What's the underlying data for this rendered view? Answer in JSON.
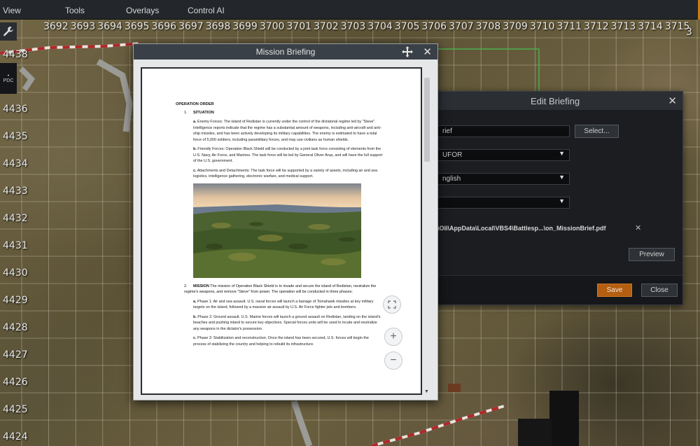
{
  "menu": {
    "items": [
      "View",
      "Tools",
      "Overlays",
      "Control AI"
    ]
  },
  "map": {
    "x_coords": [
      "3692",
      "3693",
      "3694",
      "3695",
      "3696",
      "3697",
      "3698",
      "3699",
      "3700",
      "3701",
      "3702",
      "3703",
      "3704",
      "3705",
      "3706",
      "3707",
      "3708",
      "3709",
      "3710",
      "3711",
      "3712",
      "3713",
      "3714",
      "3715"
    ],
    "y_coords": [
      "4438",
      "37",
      "4436",
      "4435",
      "4434",
      "4433",
      "4432",
      "4431",
      "4430",
      "4429",
      "4428",
      "4427",
      "4426",
      "4425",
      "4424"
    ],
    "y_coord_corner": "3",
    "colors": {
      "grid": "#c8c4b0",
      "road_red": "#b0282a",
      "road_white": "#e8e4dc"
    }
  },
  "left_tools": {
    "wrench_icon": "wrench-icon",
    "pdc_label": "PDC",
    "pdc_dot": "•"
  },
  "mission_briefing": {
    "title": "Mission Briefing",
    "move_icon": "move-icon",
    "close_label": "✕",
    "document": {
      "heading": "OPERATION ORDER",
      "section1_num": "1.",
      "section1_title": "SITUATION",
      "para_a_label": "a.",
      "para_a": "Enemy Forces: The island of Redistan is currently under the control of the dictatorial regime led by \"Steve\". Intelligence reports indicate that the regime has a substantial amount of weapons, including anti-aircraft and anti-ship missiles, and has been actively developing its military capabilities. The enemy is estimated to have a total force of 5,000 soldiers, including paramilitary forces, and may use civilians as human shields.",
      "para_b_label": "b.",
      "para_b": "Friendly Forces: Operation Black Shield will be conducted by a joint task force consisting of elements from the U.S. Navy, Air Force, and Marines. The task force will be led by General Oliver Arup, and will have the full support of the U.S. government.",
      "para_c_label": "c.",
      "para_c": "Attachments and Detachments: The task force will be supported by a variety of assets, including air and sea logistics, intelligence gathering, electronic warfare, and medical support.",
      "section2_num": "2.",
      "section2_title": "MISSION",
      "section2_text": "The mission of Operation Black Shield is to invade and secure the island of Redistan, neutralize the regime's weapons, and remove \"Steve\" from power. The operation will be conducted in three phases:",
      "phase1_label": "a.",
      "phase1": "Phase 1: Air and sea assault. U.S. naval forces will launch a barrage of Tomahawk missiles at key military targets on the island, followed by a massive air assault by U.S. Air Force fighter jets and bombers.",
      "phase2_label": "b.",
      "phase2": "Phase 2: Ground assault. U.S. Marine forces will launch a ground assault on Redistan, landing on the island's beaches and pushing inland to secure key objectives. Special forces units will be used to locate and neutralize any weapons in the dictator's possession.",
      "phase3_label": "c.",
      "phase3": "Phase 3: Stabilization and reconstruction. Once the island has been secured, U.S. forces will begin the process of stabilizing the country and helping to rebuild its infrastructure."
    },
    "zoom": {
      "fit_icon": "fit-screen-icon",
      "zoom_in_label": "+",
      "zoom_out_label": "−"
    },
    "scroll_down": "▼"
  },
  "edit_briefing": {
    "title": "Edit Briefing",
    "close_label": "✕",
    "fields": {
      "brief_value": "rief",
      "select_label": "Select...",
      "side_value": "UFOR",
      "language_value": "nglish",
      "type_value": "",
      "caret": "▼"
    },
    "path": "\\Oli\\AppData\\Local\\VBS4\\Battlesp...\\on_MissionBrief.pdf",
    "path_remove": "✕",
    "preview_label": "Preview",
    "save_label": "Save",
    "close_button_label": "Close",
    "accent_color": "#b35e10"
  }
}
